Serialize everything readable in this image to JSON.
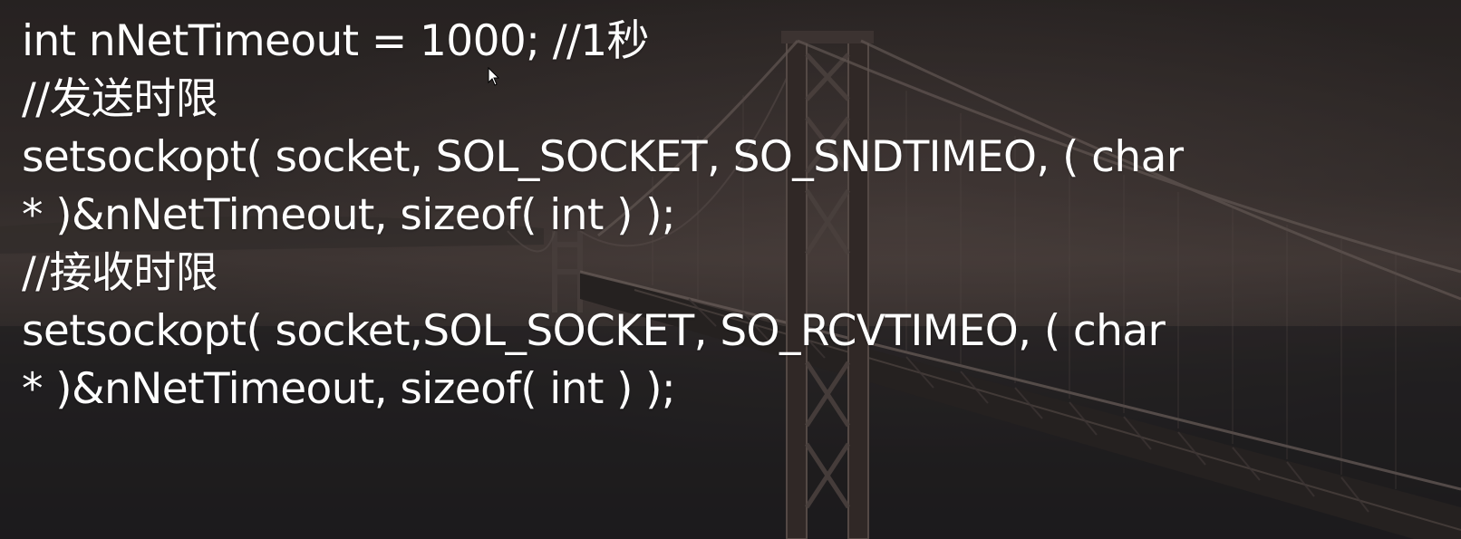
{
  "slide": {
    "lines": [
      "int nNetTimeout = 1000; //1秒",
      "//发送时限",
      "setsockopt( socket, SOL_SOCKET, SO_SNDTIMEO, ( char",
      "* )&nNetTimeout, sizeof( int ) );",
      "//接收时限",
      "setsockopt( socket,SOL_SOCKET, SO_RCVTIMEO, ( char",
      "* )&nNetTimeout, sizeof( int ) );"
    ]
  },
  "background": {
    "subject": "bridge-photo",
    "text_color": "#ffffff"
  },
  "cursor": {
    "icon": "mouse-pointer-icon"
  }
}
